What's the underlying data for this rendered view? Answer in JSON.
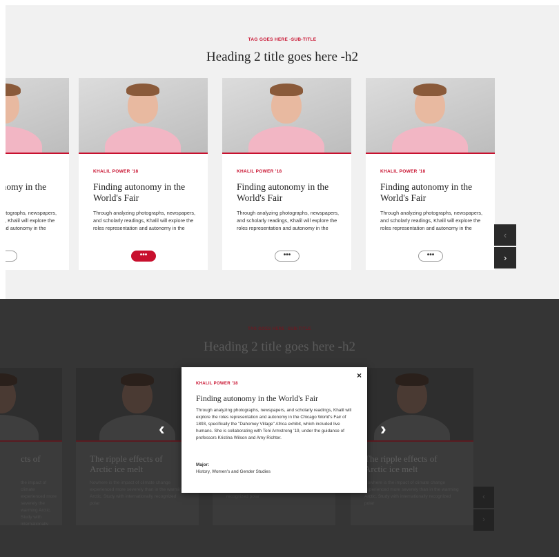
{
  "top": {
    "subtitle": "TAG GOES HERE -SUB-TITLE",
    "heading": "Heading 2 title goes here -h2",
    "cards": [
      {
        "byline": "",
        "title": "Finding autonomy in the",
        "desc": "Through analyzing photographs, newspapers, and scholarly readings, Khalil will explore the roles representation and autonomy in the"
      },
      {
        "byline": "KHALIL POWER '18",
        "title": "Finding autonomy in the World's Fair",
        "desc": "Through analyzing photographs, newspapers, and scholarly readings, Khalil will explore the roles representation and autonomy in the",
        "more": "•••",
        "active": true
      },
      {
        "byline": "KHALIL POWER '18",
        "title": "Finding autonomy in the World's Fair",
        "desc": "Through analyzing photographs, newspapers, and scholarly readings, Khalil will explore the roles representation and autonomy in the",
        "more": "•••"
      },
      {
        "byline": "KHALIL POWER '18",
        "title": "Finding autonomy in the World's Fair",
        "desc": "Through analyzing photographs, newspapers, and scholarly readings, Khalil will explore the roles representation and autonomy in the",
        "more": "•••"
      }
    ],
    "prev_icon": "‹",
    "next_icon": "›"
  },
  "bottom": {
    "subtitle": "TAG GOES HERE -SUB-TITLE",
    "heading": "Heading 2 title goes here -h2",
    "cards": [
      {
        "title": "cts of",
        "desc": "the impact of climate experienced more severely the warming Arctic. Study with internationally polar"
      },
      {
        "title": "The ripple effects of Arctic ice melt",
        "desc": "Nowhere is the impact of climate change experienced more severely than in the warming Arctic. Study with internationally recognized polar"
      },
      {
        "title": "",
        "desc": "change experienced more severely than in the warming Arctic. Study with internationally recognized polar"
      },
      {
        "title": "The ripple effects of Arctic ice melt",
        "desc": "Nowhere is the impact of climate change experienced more severely than in the warming Arctic. Study with internationally recognized polar"
      }
    ],
    "prev_icon": "‹",
    "next_icon": "›",
    "overlay_prev": "‹",
    "overlay_next": "›"
  },
  "modal": {
    "close": "×",
    "byline": "KHALIL POWER '18",
    "title": "Finding autonomy in the World's Fair",
    "desc": "Through analyzing photographs, newspapers, and scholarly readings, Khalil will explore the roles representation and autonomy in the Chicago World's Fair of 1893, specifically the \"Dahomey Village\" Africa exhibit, which included live humans. She is collaborating with Toni Armstrong '19, under the guidance of professors Kristina Wilson and Amy Richter.",
    "major_label": "Major:",
    "major": "History, Women's and Gender Studies"
  },
  "colors": {
    "accent": "#c8102e",
    "panel": "#f1f1f1",
    "overlay": "#353535"
  }
}
